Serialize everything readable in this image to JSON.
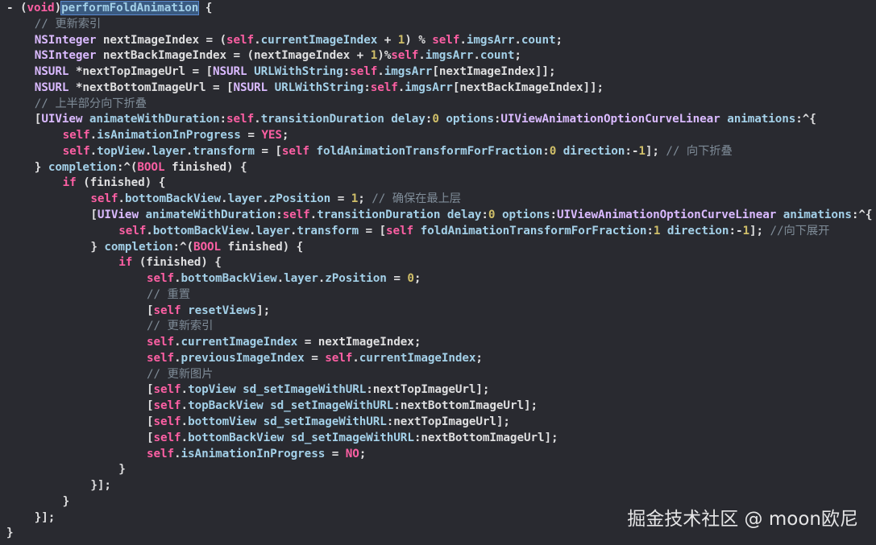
{
  "colors": {
    "background": "#292a30",
    "plain": "#dfdfe0",
    "keyword": "#fc5fa3",
    "type": "#dabaff",
    "property": "#a3d0e8",
    "number": "#d0bf69",
    "comment": "#7f8c98",
    "selection": "#3a5a80"
  },
  "watermark": "掘金技术社区 @ moon欧尼",
  "lines": [
    {
      "indent": 0,
      "tokens": [
        [
          "- (",
          "plain"
        ],
        [
          "void",
          "kw"
        ],
        [
          ")",
          "plain"
        ],
        [
          "performFoldAnimation",
          "sel"
        ],
        [
          " {",
          "plain"
        ]
      ]
    },
    {
      "indent": 1,
      "tokens": [
        [
          "// 更新索引",
          "com"
        ]
      ]
    },
    {
      "indent": 1,
      "tokens": [
        [
          "NSInteger",
          "type"
        ],
        [
          " nextImageIndex = (",
          "plain"
        ],
        [
          "self",
          "kw"
        ],
        [
          ".",
          "plain"
        ],
        [
          "currentImageIndex",
          "prop"
        ],
        [
          " + ",
          "plain"
        ],
        [
          "1",
          "num"
        ],
        [
          ") % ",
          "plain"
        ],
        [
          "self",
          "kw"
        ],
        [
          ".",
          "plain"
        ],
        [
          "imgsArr",
          "prop"
        ],
        [
          ".",
          "plain"
        ],
        [
          "count",
          "prop"
        ],
        [
          ";",
          "plain"
        ]
      ]
    },
    {
      "indent": 1,
      "tokens": [
        [
          "NSInteger",
          "type"
        ],
        [
          " nextBackImageIndex = (nextImageIndex + ",
          "plain"
        ],
        [
          "1",
          "num"
        ],
        [
          ")%",
          "plain"
        ],
        [
          "self",
          "kw"
        ],
        [
          ".",
          "plain"
        ],
        [
          "imgsArr",
          "prop"
        ],
        [
          ".",
          "plain"
        ],
        [
          "count",
          "prop"
        ],
        [
          ";",
          "plain"
        ]
      ]
    },
    {
      "indent": 1,
      "tokens": [
        [
          "NSURL",
          "type"
        ],
        [
          " *nextTopImageUrl = [",
          "plain"
        ],
        [
          "NSURL",
          "type"
        ],
        [
          " ",
          "plain"
        ],
        [
          "URLWithString",
          "meth"
        ],
        [
          ":",
          "plain"
        ],
        [
          "self",
          "kw"
        ],
        [
          ".",
          "plain"
        ],
        [
          "imgsArr",
          "prop"
        ],
        [
          "[nextImageIndex]];",
          "plain"
        ]
      ]
    },
    {
      "indent": 1,
      "tokens": [
        [
          "NSURL",
          "type"
        ],
        [
          " *nextBottomImageUrl = [",
          "plain"
        ],
        [
          "NSURL",
          "type"
        ],
        [
          " ",
          "plain"
        ],
        [
          "URLWithString",
          "meth"
        ],
        [
          ":",
          "plain"
        ],
        [
          "self",
          "kw"
        ],
        [
          ".",
          "plain"
        ],
        [
          "imgsArr",
          "prop"
        ],
        [
          "[nextBackImageIndex]];",
          "plain"
        ]
      ]
    },
    {
      "indent": 1,
      "tokens": [
        [
          "// 上半部分向下折叠",
          "com"
        ]
      ]
    },
    {
      "indent": 1,
      "tokens": [
        [
          "[",
          "plain"
        ],
        [
          "UIView",
          "type"
        ],
        [
          " ",
          "plain"
        ],
        [
          "animateWithDuration",
          "meth"
        ],
        [
          ":",
          "plain"
        ],
        [
          "self",
          "kw"
        ],
        [
          ".",
          "plain"
        ],
        [
          "transitionDuration",
          "prop"
        ],
        [
          " ",
          "plain"
        ],
        [
          "delay",
          "meth"
        ],
        [
          ":",
          "plain"
        ],
        [
          "0",
          "num"
        ],
        [
          " ",
          "plain"
        ],
        [
          "options",
          "meth"
        ],
        [
          ":",
          "plain"
        ],
        [
          "UIViewAnimationOptionCurveLinear",
          "type"
        ],
        [
          " ",
          "plain"
        ],
        [
          "animations",
          "meth"
        ],
        [
          ":^{",
          "plain"
        ]
      ]
    },
    {
      "indent": 2,
      "tokens": [
        [
          "self",
          "kw"
        ],
        [
          ".",
          "plain"
        ],
        [
          "isAnimationInProgress",
          "prop"
        ],
        [
          " = ",
          "plain"
        ],
        [
          "YES",
          "kw"
        ],
        [
          ";",
          "plain"
        ]
      ]
    },
    {
      "indent": 2,
      "tokens": [
        [
          "self",
          "kw"
        ],
        [
          ".",
          "plain"
        ],
        [
          "topView",
          "prop"
        ],
        [
          ".",
          "plain"
        ],
        [
          "layer",
          "prop"
        ],
        [
          ".",
          "plain"
        ],
        [
          "transform",
          "prop"
        ],
        [
          " = [",
          "plain"
        ],
        [
          "self",
          "kw"
        ],
        [
          " ",
          "plain"
        ],
        [
          "foldAnimationTransformForFraction",
          "meth"
        ],
        [
          ":",
          "plain"
        ],
        [
          "0",
          "num"
        ],
        [
          " ",
          "plain"
        ],
        [
          "direction",
          "meth"
        ],
        [
          ":-",
          "plain"
        ],
        [
          "1",
          "num"
        ],
        [
          "]; ",
          "plain"
        ],
        [
          "// 向下折叠",
          "com"
        ]
      ]
    },
    {
      "indent": 1,
      "tokens": [
        [
          "} ",
          "plain"
        ],
        [
          "completion",
          "meth"
        ],
        [
          ":^(",
          "plain"
        ],
        [
          "BOOL",
          "kw"
        ],
        [
          " finished) {",
          "plain"
        ]
      ]
    },
    {
      "indent": 2,
      "tokens": [
        [
          "if",
          "kw"
        ],
        [
          " (finished) {",
          "plain"
        ]
      ]
    },
    {
      "indent": 3,
      "tokens": [
        [
          "self",
          "kw"
        ],
        [
          ".",
          "plain"
        ],
        [
          "bottomBackView",
          "prop"
        ],
        [
          ".",
          "plain"
        ],
        [
          "layer",
          "prop"
        ],
        [
          ".",
          "plain"
        ],
        [
          "zPosition",
          "prop"
        ],
        [
          " = ",
          "plain"
        ],
        [
          "1",
          "num"
        ],
        [
          "; ",
          "plain"
        ],
        [
          "// 确保在最上层",
          "com"
        ]
      ]
    },
    {
      "indent": 3,
      "tokens": [
        [
          "[",
          "plain"
        ],
        [
          "UIView",
          "type"
        ],
        [
          " ",
          "plain"
        ],
        [
          "animateWithDuration",
          "meth"
        ],
        [
          ":",
          "plain"
        ],
        [
          "self",
          "kw"
        ],
        [
          ".",
          "plain"
        ],
        [
          "transitionDuration",
          "prop"
        ],
        [
          " ",
          "plain"
        ],
        [
          "delay",
          "meth"
        ],
        [
          ":",
          "plain"
        ],
        [
          "0",
          "num"
        ],
        [
          " ",
          "plain"
        ],
        [
          "options",
          "meth"
        ],
        [
          ":",
          "plain"
        ],
        [
          "UIViewAnimationOptionCurveLinear",
          "type"
        ],
        [
          " ",
          "plain"
        ],
        [
          "animations",
          "meth"
        ],
        [
          ":^{",
          "plain"
        ]
      ]
    },
    {
      "indent": 4,
      "tokens": [
        [
          "self",
          "kw"
        ],
        [
          ".",
          "plain"
        ],
        [
          "bottomBackView",
          "prop"
        ],
        [
          ".",
          "plain"
        ],
        [
          "layer",
          "prop"
        ],
        [
          ".",
          "plain"
        ],
        [
          "transform",
          "prop"
        ],
        [
          " = [",
          "plain"
        ],
        [
          "self",
          "kw"
        ],
        [
          " ",
          "plain"
        ],
        [
          "foldAnimationTransformForFraction",
          "meth"
        ],
        [
          ":",
          "plain"
        ],
        [
          "1",
          "num"
        ],
        [
          " ",
          "plain"
        ],
        [
          "direction",
          "meth"
        ],
        [
          ":-",
          "plain"
        ],
        [
          "1",
          "num"
        ],
        [
          "]; ",
          "plain"
        ],
        [
          "//向下展开",
          "com"
        ]
      ]
    },
    {
      "indent": 3,
      "tokens": [
        [
          "} ",
          "plain"
        ],
        [
          "completion",
          "meth"
        ],
        [
          ":^(",
          "plain"
        ],
        [
          "BOOL",
          "kw"
        ],
        [
          " finished) {",
          "plain"
        ]
      ]
    },
    {
      "indent": 4,
      "tokens": [
        [
          "if",
          "kw"
        ],
        [
          " (finished) {",
          "plain"
        ]
      ]
    },
    {
      "indent": 5,
      "tokens": [
        [
          "self",
          "kw"
        ],
        [
          ".",
          "plain"
        ],
        [
          "bottomBackView",
          "prop"
        ],
        [
          ".",
          "plain"
        ],
        [
          "layer",
          "prop"
        ],
        [
          ".",
          "plain"
        ],
        [
          "zPosition",
          "prop"
        ],
        [
          " = ",
          "plain"
        ],
        [
          "0",
          "num"
        ],
        [
          ";",
          "plain"
        ]
      ]
    },
    {
      "indent": 5,
      "tokens": [
        [
          "// 重置",
          "com"
        ]
      ]
    },
    {
      "indent": 5,
      "tokens": [
        [
          "[",
          "plain"
        ],
        [
          "self",
          "kw"
        ],
        [
          " ",
          "plain"
        ],
        [
          "resetViews",
          "meth"
        ],
        [
          "];",
          "plain"
        ]
      ]
    },
    {
      "indent": 5,
      "tokens": [
        [
          "// 更新索引",
          "com"
        ]
      ]
    },
    {
      "indent": 5,
      "tokens": [
        [
          "self",
          "kw"
        ],
        [
          ".",
          "plain"
        ],
        [
          "currentImageIndex",
          "prop"
        ],
        [
          " = nextImageIndex;",
          "plain"
        ]
      ]
    },
    {
      "indent": 5,
      "tokens": [
        [
          "self",
          "kw"
        ],
        [
          ".",
          "plain"
        ],
        [
          "previousImageIndex",
          "prop"
        ],
        [
          " = ",
          "plain"
        ],
        [
          "self",
          "kw"
        ],
        [
          ".",
          "plain"
        ],
        [
          "currentImageIndex",
          "prop"
        ],
        [
          ";",
          "plain"
        ]
      ]
    },
    {
      "indent": 5,
      "tokens": [
        [
          "// 更新图片",
          "com"
        ]
      ]
    },
    {
      "indent": 5,
      "tokens": [
        [
          "[",
          "plain"
        ],
        [
          "self",
          "kw"
        ],
        [
          ".",
          "plain"
        ],
        [
          "topView",
          "prop"
        ],
        [
          " ",
          "plain"
        ],
        [
          "sd_setImageWithURL",
          "meth"
        ],
        [
          ":nextTopImageUrl];",
          "plain"
        ]
      ]
    },
    {
      "indent": 5,
      "tokens": [
        [
          "[",
          "plain"
        ],
        [
          "self",
          "kw"
        ],
        [
          ".",
          "plain"
        ],
        [
          "topBackView",
          "prop"
        ],
        [
          " ",
          "plain"
        ],
        [
          "sd_setImageWithURL",
          "meth"
        ],
        [
          ":nextBottomImageUrl];",
          "plain"
        ]
      ]
    },
    {
      "indent": 5,
      "tokens": [
        [
          "[",
          "plain"
        ],
        [
          "self",
          "kw"
        ],
        [
          ".",
          "plain"
        ],
        [
          "bottomView",
          "prop"
        ],
        [
          " ",
          "plain"
        ],
        [
          "sd_setImageWithURL",
          "meth"
        ],
        [
          ":nextTopImageUrl];",
          "plain"
        ]
      ]
    },
    {
      "indent": 5,
      "tokens": [
        [
          "[",
          "plain"
        ],
        [
          "self",
          "kw"
        ],
        [
          ".",
          "plain"
        ],
        [
          "bottomBackView",
          "prop"
        ],
        [
          " ",
          "plain"
        ],
        [
          "sd_setImageWithURL",
          "meth"
        ],
        [
          ":nextBottomImageUrl];",
          "plain"
        ]
      ]
    },
    {
      "indent": 5,
      "tokens": [
        [
          "self",
          "kw"
        ],
        [
          ".",
          "plain"
        ],
        [
          "isAnimationInProgress",
          "prop"
        ],
        [
          " = ",
          "plain"
        ],
        [
          "NO",
          "kw"
        ],
        [
          ";",
          "plain"
        ]
      ]
    },
    {
      "indent": 4,
      "tokens": [
        [
          "}",
          "plain"
        ]
      ]
    },
    {
      "indent": 3,
      "tokens": [
        [
          "}];",
          "plain"
        ]
      ]
    },
    {
      "indent": 2,
      "tokens": [
        [
          "}",
          "plain"
        ]
      ]
    },
    {
      "indent": 1,
      "tokens": [
        [
          "}];",
          "plain"
        ]
      ]
    },
    {
      "indent": 0,
      "tokens": [
        [
          "}",
          "plain"
        ]
      ]
    }
  ]
}
